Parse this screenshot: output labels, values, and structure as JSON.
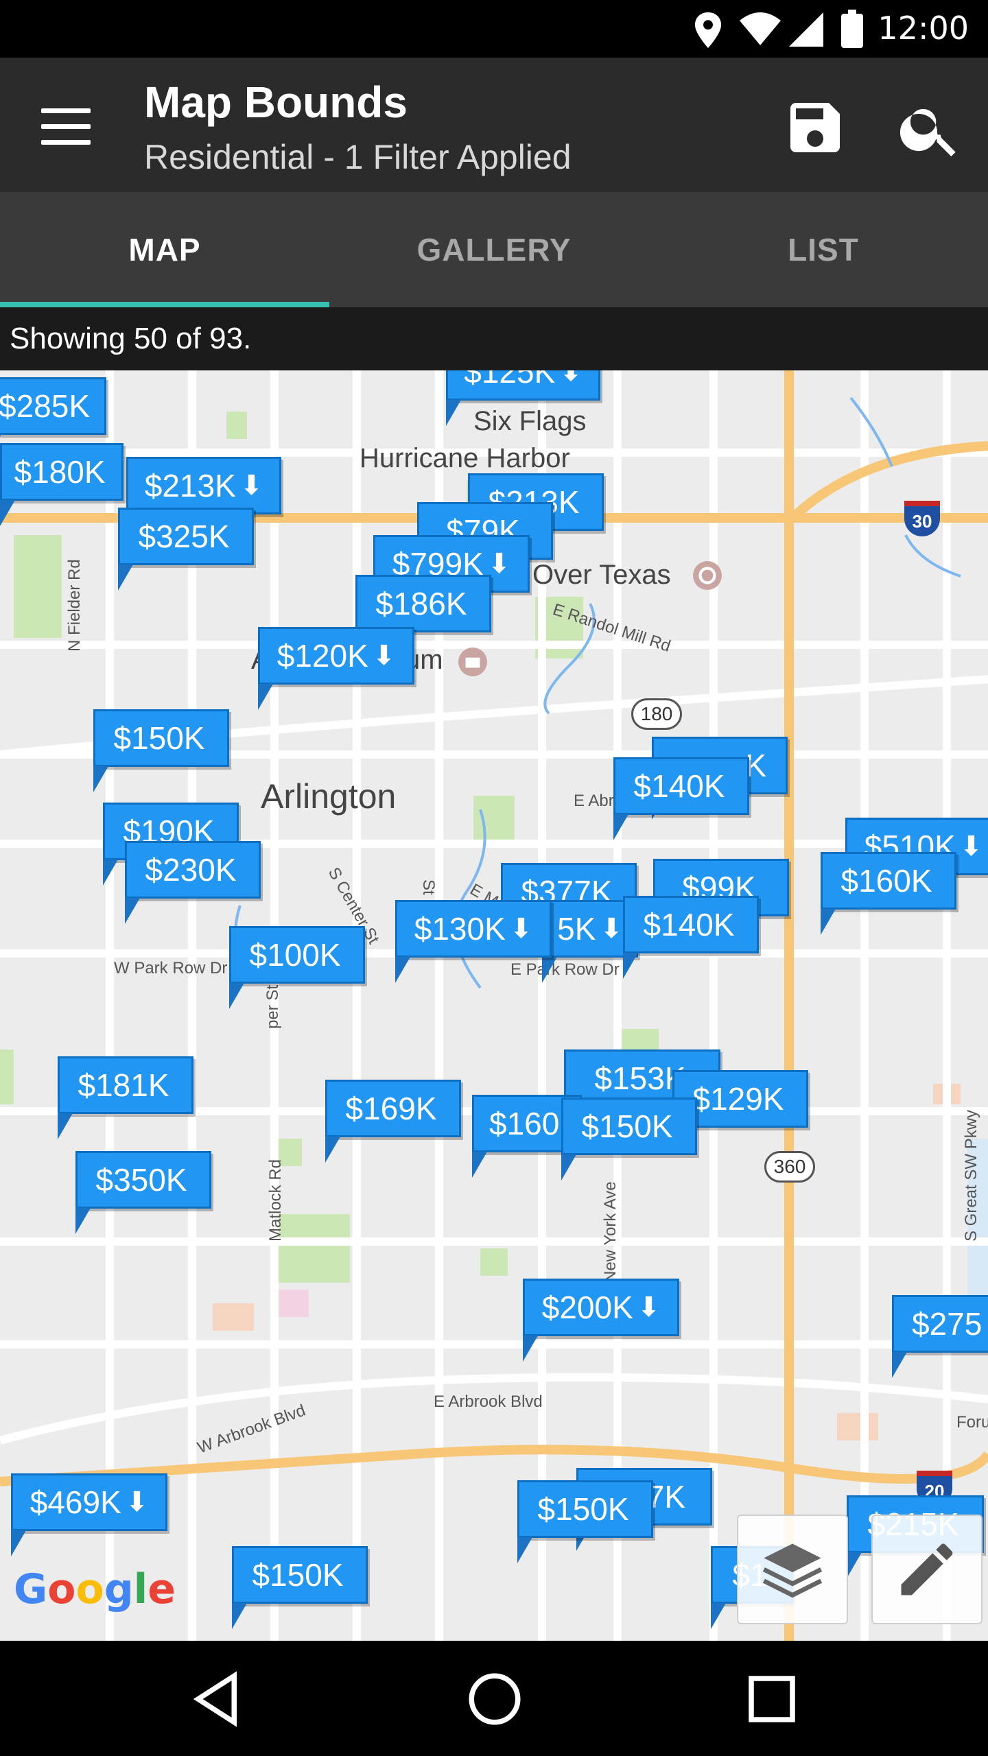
{
  "status": {
    "time": "12:00"
  },
  "appbar": {
    "title": "Map Bounds",
    "subtitle": "Residential - 1 Filter Applied"
  },
  "tabs": [
    {
      "label": "MAP",
      "active": true
    },
    {
      "label": "GALLERY",
      "active": false
    },
    {
      "label": "LIST",
      "active": false
    }
  ],
  "showing": "Showing 50 of 93.",
  "map": {
    "places": {
      "six_flags": "Six Flags",
      "hurricane": "Hurricane Harbor",
      "over_texas": "Over Texas",
      "arlington": "Arlington",
      "um": "um",
      "a": "A",
      "forum": "Forun"
    },
    "streets": {
      "fielder": "N Fielder Rd",
      "randol": "E Randol Mill Rd",
      "abram": "E Abr",
      "center": "S Center St",
      "park_w": "W Park Row Dr",
      "park_e": "E Park Row Dr",
      "cooper": "per St",
      "matlock": "Matlock Rd",
      "newyork": "New York Ave",
      "arbrook_w": "W Arbrook Blvd",
      "arbrook_e": "E Arbrook Blvd",
      "greatsw": "S Great SW Pkwy",
      "sts": "St S",
      "em": "E M"
    },
    "shields": {
      "i30": "30",
      "i20": "20",
      "h180": "180",
      "h360": "360"
    },
    "pins": [
      {
        "label": "$285K",
        "arrow": ""
      },
      {
        "label": "$125K",
        "arrow": "⬇"
      },
      {
        "label": "$180K",
        "arrow": ""
      },
      {
        "label": "$213K",
        "arrow": "⬇"
      },
      {
        "label": "$213K",
        "arrow": ""
      },
      {
        "label": "$325K",
        "arrow": ""
      },
      {
        "label": "$79K",
        "arrow": ""
      },
      {
        "label": "$799K",
        "arrow": "⬇"
      },
      {
        "label": "$186K",
        "arrow": ""
      },
      {
        "label": "$120K",
        "arrow": "⬇"
      },
      {
        "label": "$150K",
        "arrow": ""
      },
      {
        "label": "K",
        "arrow": ""
      },
      {
        "label": "$140K",
        "arrow": ""
      },
      {
        "label": "$190K",
        "arrow": ""
      },
      {
        "label": "$230K",
        "arrow": ""
      },
      {
        "label": "$510K",
        "arrow": "⬇"
      },
      {
        "label": "$160K",
        "arrow": ""
      },
      {
        "label": "$377K",
        "arrow": ""
      },
      {
        "label": "$99K",
        "arrow": ""
      },
      {
        "label": "$130K",
        "arrow": "⬇"
      },
      {
        "label": "5K",
        "arrow": "⬇"
      },
      {
        "label": "$140K",
        "arrow": ""
      },
      {
        "label": "$100K",
        "arrow": ""
      },
      {
        "label": "$153K",
        "arrow": ""
      },
      {
        "label": "$181K",
        "arrow": ""
      },
      {
        "label": "$169K",
        "arrow": ""
      },
      {
        "label": "$160",
        "arrow": ""
      },
      {
        "label": "$150K",
        "arrow": ""
      },
      {
        "label": "$129K",
        "arrow": ""
      },
      {
        "label": "$350K",
        "arrow": ""
      },
      {
        "label": "$200K",
        "arrow": "⬇"
      },
      {
        "label": "$275",
        "arrow": ""
      },
      {
        "label": "$469K",
        "arrow": "⬇"
      },
      {
        "label": "7K",
        "arrow": ""
      },
      {
        "label": "$150K",
        "arrow": ""
      },
      {
        "label": "$215K",
        "arrow": ""
      },
      {
        "label": "$150K",
        "arrow": ""
      },
      {
        "label": "$1",
        "arrow": ""
      }
    ],
    "google": [
      "G",
      "o",
      "o",
      "g",
      "l",
      "e"
    ]
  },
  "colors": {
    "pin": "#2196f3",
    "tab_indicator": "#35c0b0",
    "appbar": "#2b2b2b",
    "tabs": "#3a3a3a"
  }
}
